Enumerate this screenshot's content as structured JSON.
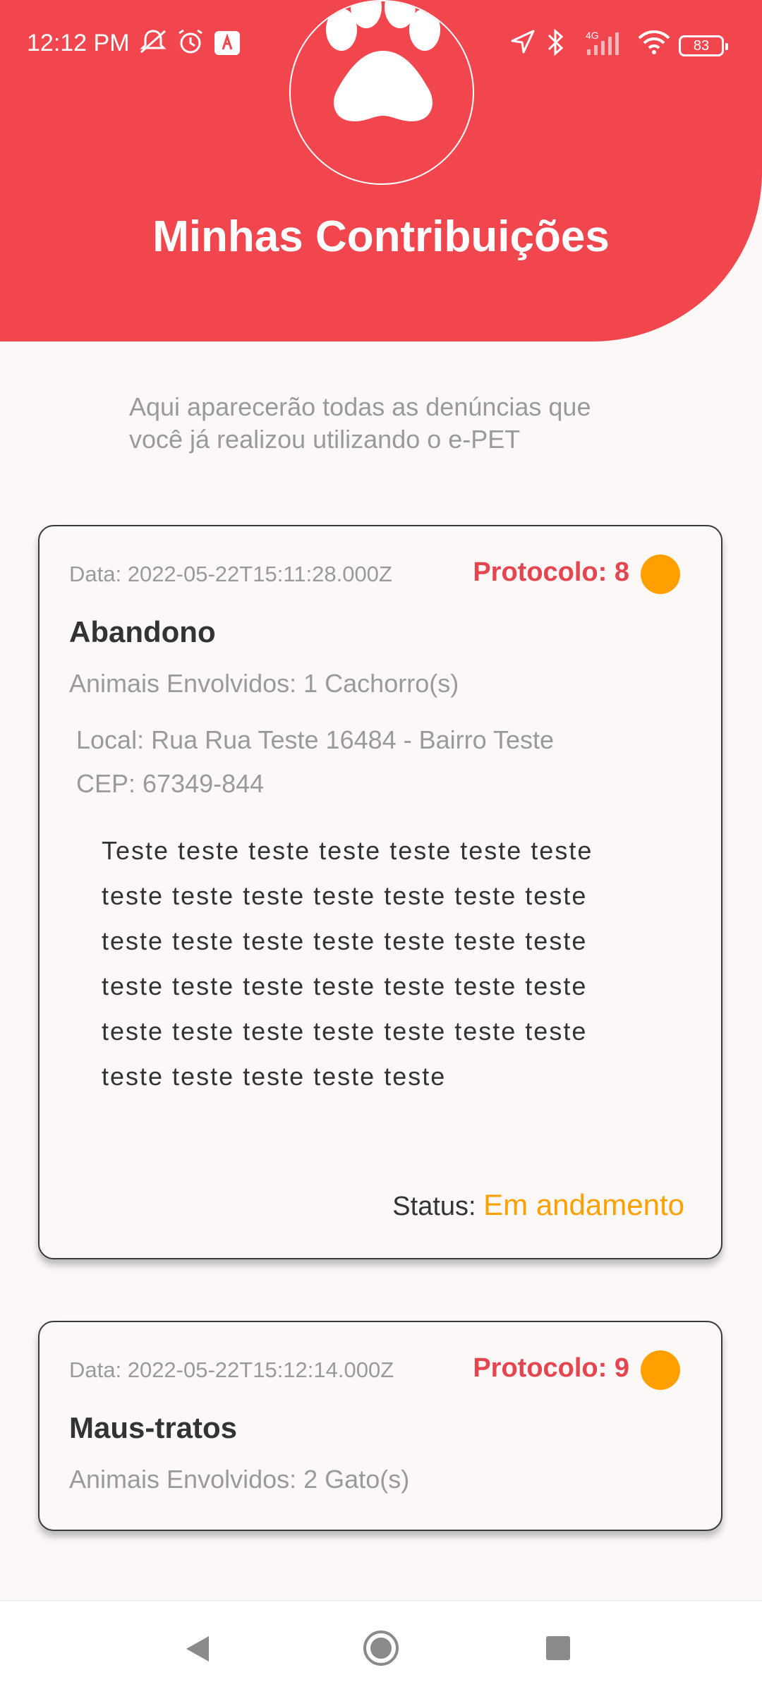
{
  "status_bar": {
    "time": "12:12 PM",
    "battery": "83",
    "network": "4G",
    "icons": [
      "silent-icon",
      "alarm-icon",
      "app-notification-icon",
      "location-icon",
      "bluetooth-icon",
      "signal-icon",
      "wifi-icon",
      "battery-icon"
    ]
  },
  "header": {
    "title": "Minhas Contribuições",
    "logo_icon": "paw-icon",
    "color": "#f2464f"
  },
  "intro": {
    "line1": "Aqui aparecerão todas as denúncias que",
    "line2": "você já realizou utilizando o e-PET"
  },
  "cards": [
    {
      "date": "Data: 2022-05-22T15:11:28.000Z",
      "protocol": "Protocolo: 8",
      "type": "Abandono",
      "animals": "Animais Envolvidos: 1 Cachorro(s)",
      "local": "Local: Rua Rua Teste 16484 - Bairro Teste",
      "cep": "CEP: 67349-844",
      "desc_lines": [
        "Teste teste teste teste teste teste teste",
        "teste teste teste teste teste teste teste",
        "teste teste teste teste teste teste teste",
        "teste teste teste teste teste teste teste",
        "teste teste teste teste teste teste teste",
        "teste teste teste teste teste"
      ],
      "status_label": "Status:",
      "status_value": "Em andamento",
      "status_color": "#ffa000"
    },
    {
      "date": "Data: 2022-05-22T15:12:14.000Z",
      "protocol": "Protocolo: 9",
      "type": "Maus-tratos",
      "animals": "Animais Envolvidos: 2 Gato(s)",
      "status_color": "#ffa000"
    }
  ],
  "nav": {
    "icons": [
      "back-icon",
      "home-icon",
      "recents-icon"
    ]
  }
}
